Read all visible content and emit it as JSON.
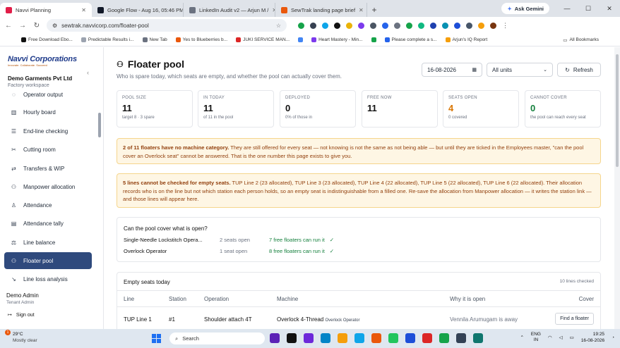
{
  "browser": {
    "tabs": [
      {
        "title": "Navvi Planning",
        "color": "#e11d48",
        "active": true
      },
      {
        "title": "Google Flow - Aug 16, 05:46 PM",
        "color": "#111827",
        "active": false
      },
      {
        "title": "LinkedIn Audit v2 — Arjun M /",
        "color": "#6b7280",
        "active": false
      },
      {
        "title": "SewTrak landing page brief",
        "color": "#ea580c",
        "active": false
      }
    ],
    "new_tab": "+",
    "gemini_label": "Ask Gemini",
    "url": "sewtrak.navvicorp.com/floater-pool",
    "bookmarks": [
      "Free Download Ebo...",
      "Predictable Results i...",
      "New Tab",
      "Yes to Blueberries b...",
      "JUKI SERVICE MAN...",
      "Heart Mastery - Min...",
      "Please complete a s...",
      "Arjun's IQ Report"
    ],
    "all_bookmarks": "All Bookmarks"
  },
  "sidebar": {
    "brand": "Navvi Corporations",
    "brand_tag": "Innovate. Collaborate. Succeed",
    "org_name": "Demo Garments Pvt Ltd",
    "org_sub": "Factory workspace",
    "partial_item": "Operator output",
    "items": [
      {
        "label": "Hourly board",
        "icon": "bars-icon"
      },
      {
        "label": "End-line checking",
        "icon": "list-icon"
      },
      {
        "label": "Cutting room",
        "icon": "scissors-icon"
      },
      {
        "label": "Transfers & WIP",
        "icon": "swap-icon"
      },
      {
        "label": "Manpower allocation",
        "icon": "people-icon"
      },
      {
        "label": "Attendance",
        "icon": "person-icon"
      },
      {
        "label": "Attendance tally",
        "icon": "clipboard-icon"
      },
      {
        "label": "Line balance",
        "icon": "scale-icon"
      },
      {
        "label": "Floater pool",
        "icon": "people-icon"
      },
      {
        "label": "Line loss analysis",
        "icon": "trend-down-icon"
      }
    ],
    "user_name": "Demo Admin",
    "user_role": "Tenant Admin",
    "sign_out": "Sign out"
  },
  "header": {
    "title": "Floater pool",
    "subtitle": "Who is spare today, which seats are empty, and whether the pool can actually cover them.",
    "date": "16-08-2026",
    "units": "All units",
    "refresh": "Refresh"
  },
  "stats": [
    {
      "label": "POOL SIZE",
      "value": "11",
      "hint": "target 8 · 3 spare",
      "tone": "default"
    },
    {
      "label": "IN TODAY",
      "value": "11",
      "hint": "of 11 in the pool",
      "tone": "default"
    },
    {
      "label": "DEPLOYED",
      "value": "0",
      "hint": "0% of those in",
      "tone": "default"
    },
    {
      "label": "FREE NOW",
      "value": "11",
      "hint": "",
      "tone": "default"
    },
    {
      "label": "SEATS OPEN",
      "value": "4",
      "hint": "0 covered",
      "tone": "orange"
    },
    {
      "label": "CANNOT COVER",
      "value": "0",
      "hint": "the pool can reach every seat",
      "tone": "green"
    }
  ],
  "alerts": [
    {
      "bold": "2 of 11 floaters have no machine category.",
      "text": " They are still offered for every seat — not knowing is not the same as not being able — but until they are ticked in the Employees master, \"can the pool cover an Overlock seat\" cannot be answered. That is the one number this page exists to give you."
    },
    {
      "bold": "5 lines cannot be checked for empty seats.",
      "text": " TUP Line 2 (23 allocated), TUP Line 3 (23 allocated), TUP Line 4 (22 allocated), TUP Line 5 (22 allocated), TUP Line 6 (22 allocated). Their allocation records who is on the line but not which station each person holds, so an empty seat is indistinguishable from a filled one. Re-save the allocation from Manpower allocation — it writes the station link — and those lines will appear here."
    }
  ],
  "coverage": {
    "heading": "Can the pool cover what is open?",
    "rows": [
      {
        "machine": "Single-Needle Lockstitch Opera...",
        "seats": "2 seats open",
        "floaters": "7 free floaters can run it",
        "check": "✓"
      },
      {
        "machine": "Overlock Operator",
        "seats": "1 seat open",
        "floaters": "8 free floaters can run it",
        "check": "✓"
      }
    ]
  },
  "empty_seats": {
    "heading": "Empty seats today",
    "checked": "10 lines checked",
    "columns": [
      "Line",
      "Station",
      "Operation",
      "Machine",
      "Why it is open",
      "Cover"
    ],
    "rows": [
      {
        "line": "TUP Line 1",
        "station": "#1",
        "operation": "Shoulder attach 4T",
        "machine": "Overlock 4-Thread",
        "machine_cat": "Overlock Operator",
        "why": "Vennila Arumugam is away",
        "action": "Find a floater"
      }
    ]
  },
  "taskbar": {
    "temp": "29°C",
    "weather": "Mostly clear",
    "badge": "1",
    "search": "Search",
    "lang1": "ENG",
    "lang2": "IN",
    "time": "19:25",
    "date": "16-08-2026"
  }
}
